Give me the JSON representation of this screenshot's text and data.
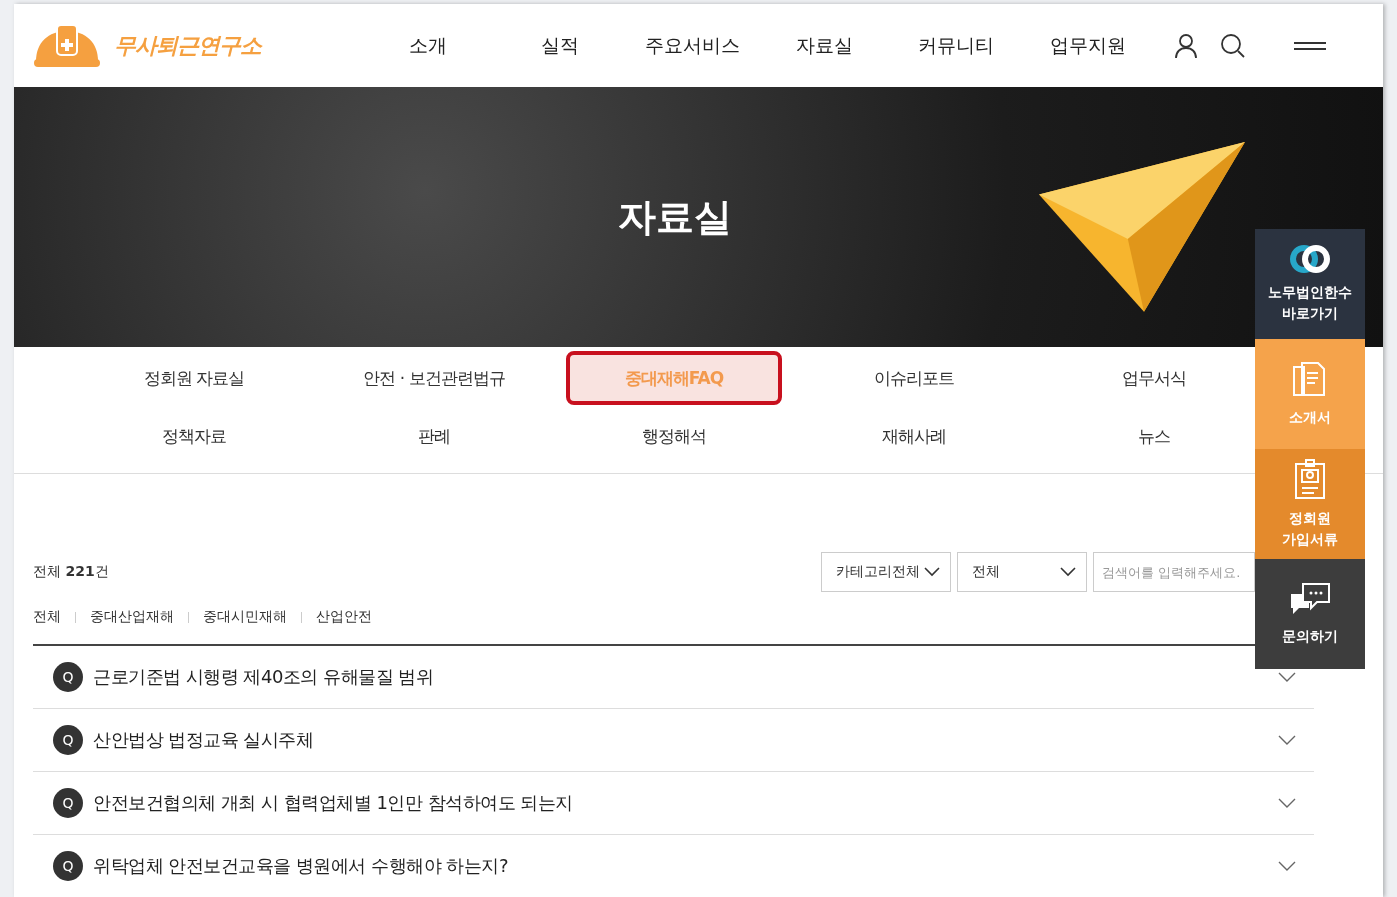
{
  "header": {
    "logo_text": "무사퇴근연구소",
    "nav": [
      "소개",
      "실적",
      "주요서비스",
      "자료실",
      "커뮤니티",
      "업무지원"
    ]
  },
  "banner": {
    "title": "자료실"
  },
  "submenu": [
    {
      "label": "정회원 자료실",
      "selected": false
    },
    {
      "label": "안전 · 보건관련법규",
      "selected": false
    },
    {
      "label": "중대재해FAQ",
      "selected": true
    },
    {
      "label": "이슈리포트",
      "selected": false
    },
    {
      "label": "업무서식",
      "selected": false
    },
    {
      "label": "정책자료",
      "selected": false
    },
    {
      "label": "판례",
      "selected": false
    },
    {
      "label": "행정해석",
      "selected": false
    },
    {
      "label": "재해사례",
      "selected": false
    },
    {
      "label": "뉴스",
      "selected": false
    }
  ],
  "quick_menu": [
    {
      "kind": "link",
      "label": "노무법인한수\n바로가기"
    },
    {
      "kind": "brochure",
      "label": "소개서"
    },
    {
      "kind": "form",
      "label": "정회원\n가입서류"
    },
    {
      "kind": "inquiry",
      "label": "문의하기"
    }
  ],
  "total": "전체 **221**건",
  "filters": {
    "category": "카테고리전체",
    "scope": "전체",
    "search_placeholder": "검색어를 입력해주세요."
  },
  "categories": [
    "전체",
    "중대산업재해",
    "중대시민재해",
    "산업안전"
  ],
  "faq": [
    {
      "badge": "Q",
      "question": "근로기준법 시행령 제40조의 유해물질 범위"
    },
    {
      "badge": "Q",
      "question": "산안법상 법정교육 실시주체"
    },
    {
      "badge": "Q",
      "question": "안전보건협의체 개최 시 협력업체별 1인만 참석하여도 되는지"
    },
    {
      "badge": "Q",
      "question": "위탁업체 안전보건교육을 병원에서 수행해야 하는지?"
    }
  ]
}
